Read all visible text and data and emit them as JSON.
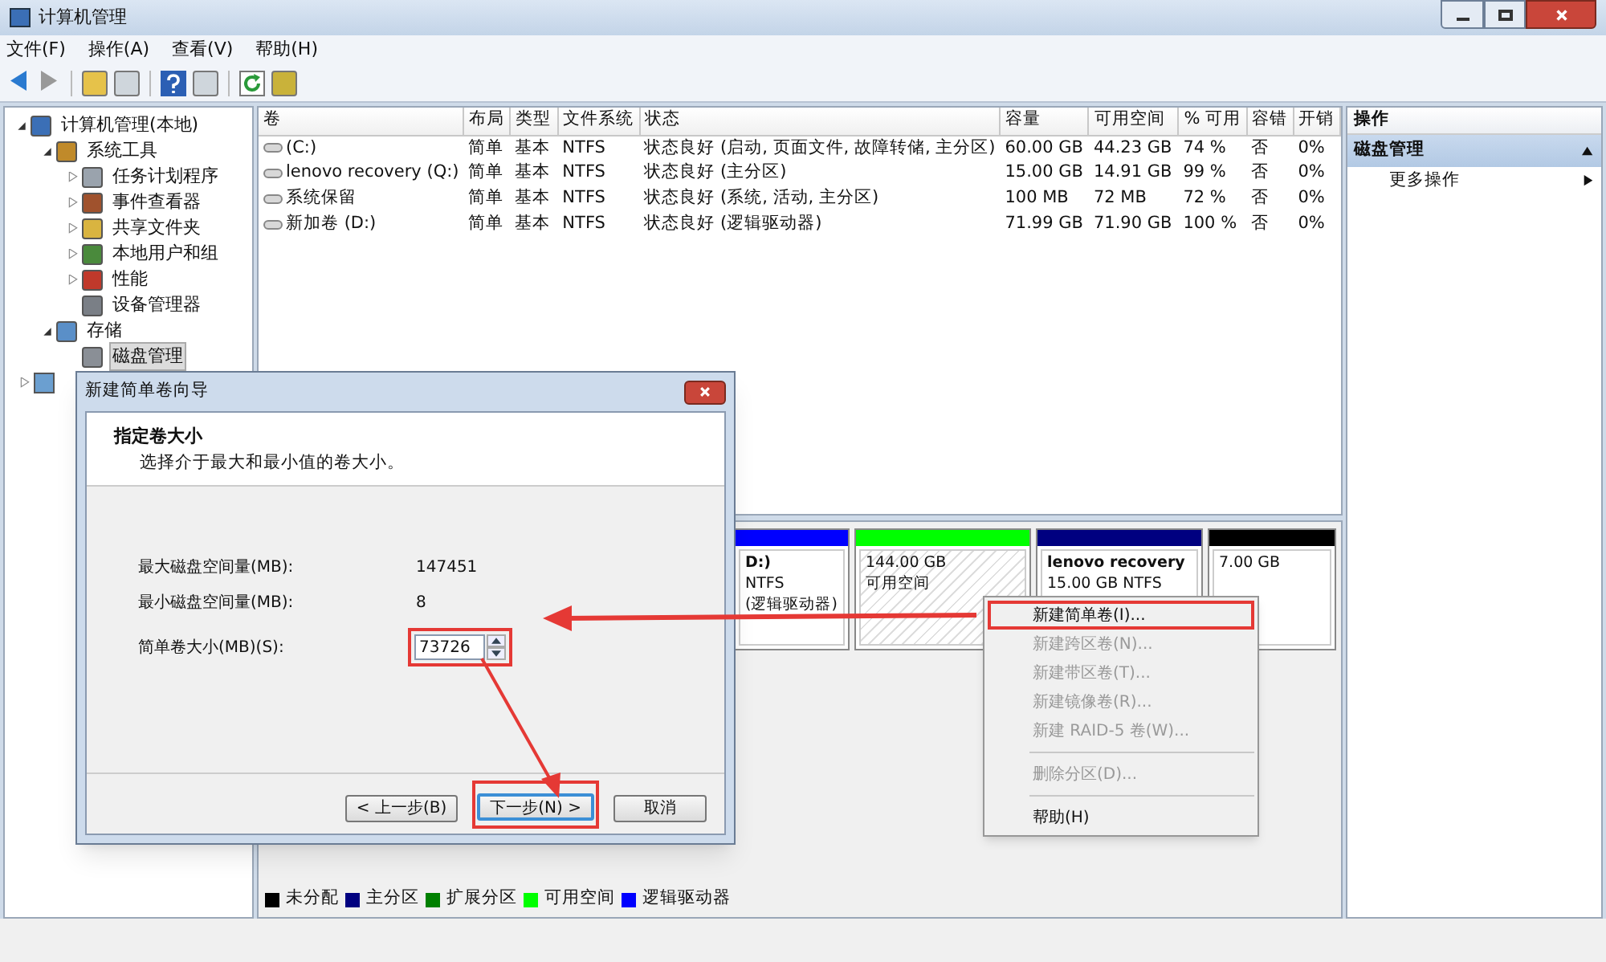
{
  "window": {
    "title": "计算机管理"
  },
  "menu": [
    "文件(F)",
    "操作(A)",
    "查看(V)",
    "帮助(H)"
  ],
  "tree": [
    {
      "label": "计算机管理(本地)",
      "expanded": true,
      "selected": false,
      "children": [
        {
          "label": "系统工具",
          "expanded": true,
          "selected": false,
          "children": [
            {
              "label": "任务计划程序",
              "expanded": false,
              "selected": false
            },
            {
              "label": "事件查看器",
              "expanded": false,
              "selected": false
            },
            {
              "label": "共享文件夹",
              "expanded": false,
              "selected": false
            },
            {
              "label": "本地用户和组",
              "expanded": false,
              "selected": false
            },
            {
              "label": "性能",
              "expanded": false,
              "selected": false
            },
            {
              "label": "设备管理器",
              "selected": false
            }
          ]
        },
        {
          "label": "存储",
          "expanded": true,
          "selected": false,
          "children": [
            {
              "label": "磁盘管理",
              "selected": true
            }
          ]
        }
      ]
    }
  ],
  "volumes": {
    "columns": [
      "卷",
      "布局",
      "类型",
      "文件系统",
      "状态",
      "容量",
      "可用空间",
      "% 可用",
      "容错",
      "开销"
    ],
    "rows": [
      [
        "(C:)",
        "简单",
        "基本",
        "NTFS",
        "状态良好 (启动, 页面文件, 故障转储, 主分区)",
        "60.00 GB",
        "44.23 GB",
        "74 %",
        "否",
        "0%"
      ],
      [
        "lenovo recovery (Q:)",
        "简单",
        "基本",
        "NTFS",
        "状态良好 (主分区)",
        "15.00 GB",
        "14.91 GB",
        "99 %",
        "否",
        "0%"
      ],
      [
        "系统保留",
        "简单",
        "基本",
        "NTFS",
        "状态良好 (系统, 活动, 主分区)",
        "100 MB",
        "72 MB",
        "72 %",
        "否",
        "0%"
      ],
      [
        "新加卷 (D:)",
        "简单",
        "基本",
        "NTFS",
        "状态良好 (逻辑驱动器)",
        "71.99 GB",
        "71.90 GB",
        "100 %",
        "否",
        "0%"
      ]
    ]
  },
  "disk_map": [
    {
      "kind": "logical",
      "color": "#0000ff",
      "lines": [
        "D:)",
        "NTFS",
        "(逻辑驱动器)"
      ]
    },
    {
      "kind": "free",
      "color": "#00ff00",
      "lines": [
        "144.00 GB",
        "可用空间"
      ]
    },
    {
      "kind": "primary",
      "color": "#000080",
      "lines": [
        "lenovo recovery",
        "15.00 GB NTFS"
      ]
    },
    {
      "kind": "unallocated",
      "color": "#000000",
      "lines": [
        "7.00 GB"
      ]
    }
  ],
  "legend": [
    {
      "label": "未分配",
      "color": "#000000"
    },
    {
      "label": "主分区",
      "color": "#000080"
    },
    {
      "label": "扩展分区",
      "color": "#008000"
    },
    {
      "label": "可用空间",
      "color": "#00ff00"
    },
    {
      "label": "逻辑驱动器",
      "color": "#0000ff"
    }
  ],
  "actions": {
    "header": "操作",
    "section": "磁盘管理",
    "items": [
      "更多操作"
    ]
  },
  "dialog": {
    "title": "新建简单卷向导",
    "heading": "指定卷大小",
    "subheading": "选择介于最大和最小值的卷大小。",
    "fields": [
      {
        "label": "最大磁盘空间量(MB):",
        "value": "147451"
      },
      {
        "label": "最小磁盘空间量(MB):",
        "value": "8"
      }
    ],
    "size_field": {
      "label": "简单卷大小(MB)(S):",
      "value": "73726",
      "annotated": true
    },
    "buttons": [
      {
        "label": "< 上一步(B)",
        "default": false,
        "annotated": false
      },
      {
        "label": "下一步(N) >",
        "default": true,
        "annotated": true
      },
      {
        "label": "取消",
        "default": false,
        "annotated": false
      }
    ]
  },
  "context_menu": [
    {
      "label": "新建简单卷(I)...",
      "disabled": false,
      "separator_before": false,
      "annotated": true
    },
    {
      "label": "新建跨区卷(N)...",
      "disabled": true,
      "separator_before": false,
      "annotated": false
    },
    {
      "label": "新建带区卷(T)...",
      "disabled": true,
      "separator_before": false,
      "annotated": false
    },
    {
      "label": "新建镜像卷(R)...",
      "disabled": true,
      "separator_before": false,
      "annotated": false
    },
    {
      "label": "新建 RAID-5 卷(W)...",
      "disabled": true,
      "separator_before": false,
      "annotated": false
    },
    {
      "label": "删除分区(D)...",
      "disabled": true,
      "separator_before": true,
      "annotated": false
    },
    {
      "label": "帮助(H)",
      "disabled": false,
      "separator_before": true,
      "annotated": false
    }
  ]
}
